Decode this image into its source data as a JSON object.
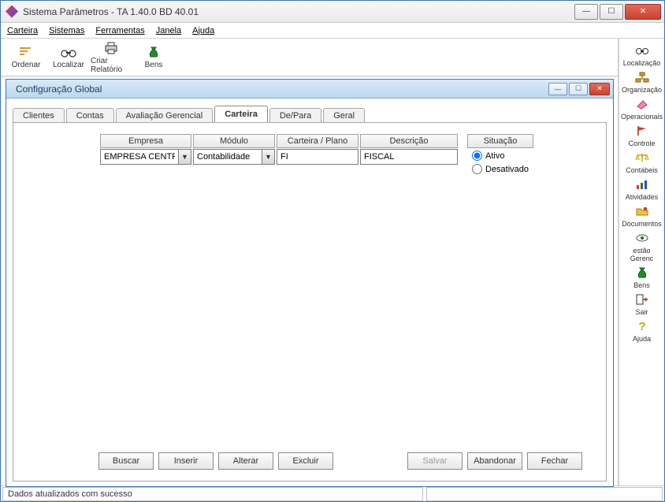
{
  "title": "Sistema Parâmetros -  TA 1.40.0 BD 40.01",
  "menus": {
    "carteira": "Carteira",
    "sistemas": "Sistemas",
    "ferramentas": "Ferramentas",
    "janela": "Janela",
    "ajuda": "Ajuda"
  },
  "toolbar": {
    "ordenar": "Ordenar",
    "localizar": "Localizar",
    "criar_relatorio": "Criar Relatório",
    "bens": "Bens"
  },
  "sidebar": {
    "localizacao": "Localização",
    "organizacao": "Organização",
    "operacionais": "Operacionais",
    "controle": "Controle",
    "contabeis": "Contábeis",
    "atividades": "Atividades",
    "documentos": "Documentos",
    "gerenc": "estão Gerenc",
    "bens": "Bens",
    "sair": "Sair",
    "ajuda": "Ajuda"
  },
  "inner": {
    "title": "Configuração Global",
    "tabs": {
      "clientes": "Clientes",
      "contas": "Contas",
      "avaliacao": "Avaliação Gerencial",
      "carteira": "Carteira",
      "depara": "De/Para",
      "geral": "Geral"
    },
    "headers": {
      "empresa": "Empresa",
      "modulo": "Módulo",
      "carteira": "Carteira / Plano",
      "descricao": "Descrição",
      "situacao": "Situação"
    },
    "values": {
      "empresa": "EMPRESA CENTRA",
      "modulo": "Contabilidade",
      "carteira": "FI",
      "descricao": "FISCAL"
    },
    "situacao": {
      "ativo": "Ativo",
      "desativado": "Desativado"
    },
    "buttons": {
      "buscar": "Buscar",
      "inserir": "Inserir",
      "alterar": "Alterar",
      "excluir": "Excluir",
      "salvar": "Salvar",
      "abandonar": "Abandonar",
      "fechar": "Fechar"
    }
  },
  "status": "Dados atualizados com sucesso",
  "glyphs": {
    "min": "—",
    "max": "☐",
    "close": "✕",
    "down": "▼"
  }
}
